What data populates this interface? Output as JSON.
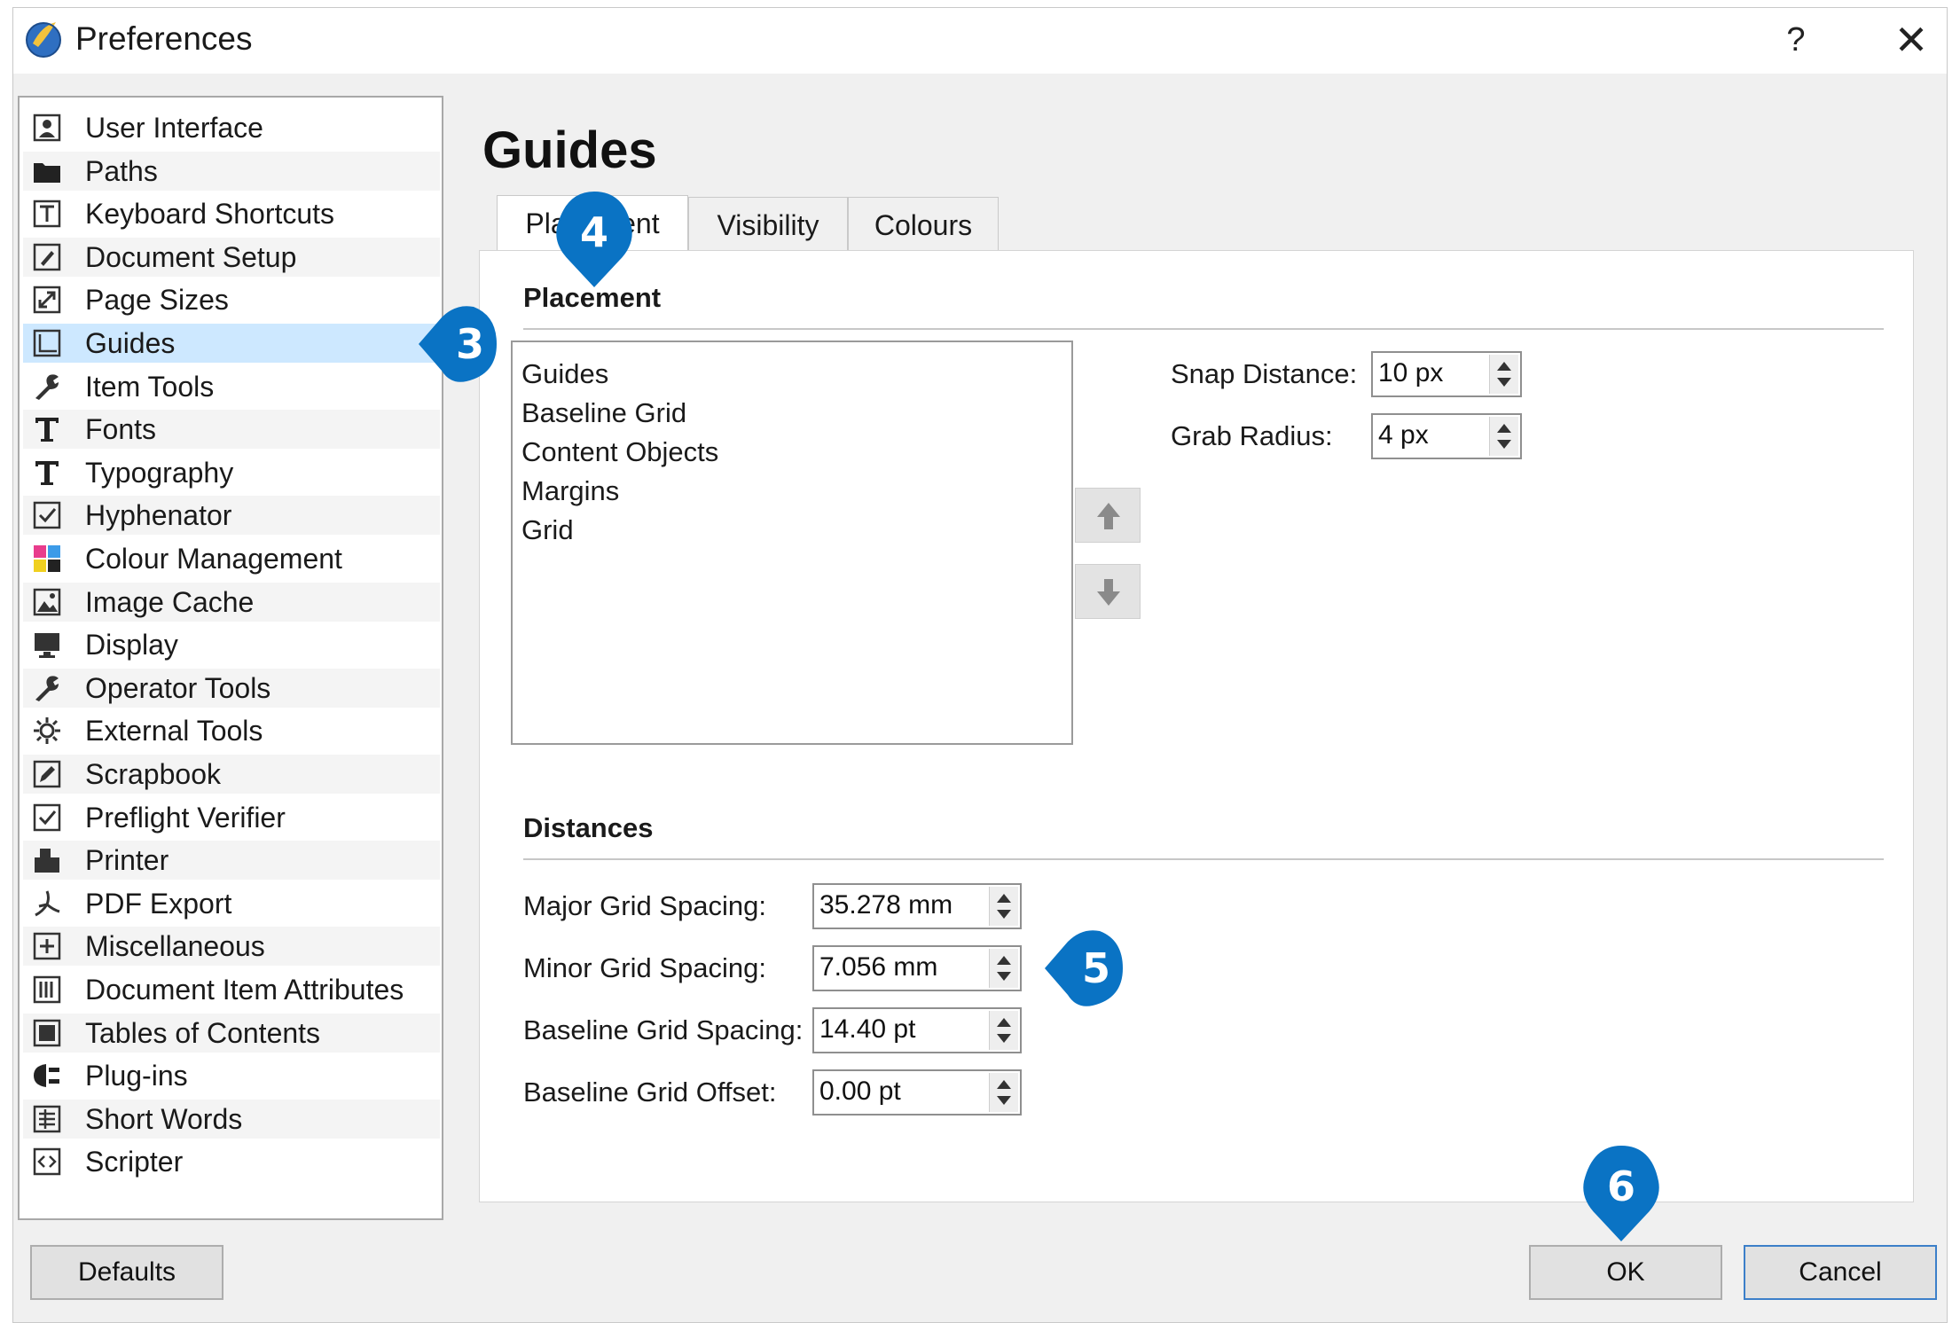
{
  "window": {
    "title": "Preferences",
    "help_label": "?",
    "close_label": "✕"
  },
  "sidebar": {
    "items": [
      {
        "label": "User Interface",
        "icon": "user-interface-icon"
      },
      {
        "label": "Paths",
        "icon": "folder-icon"
      },
      {
        "label": "Keyboard Shortcuts",
        "icon": "keyboard-icon"
      },
      {
        "label": "Document Setup",
        "icon": "document-setup-icon"
      },
      {
        "label": "Page Sizes",
        "icon": "page-sizes-icon"
      },
      {
        "label": "Guides",
        "icon": "guides-icon",
        "selected": true
      },
      {
        "label": "Item Tools",
        "icon": "wrench-icon"
      },
      {
        "label": "Fonts",
        "icon": "font-t-icon"
      },
      {
        "label": "Typography",
        "icon": "font-t-icon"
      },
      {
        "label": "Hyphenator",
        "icon": "checkbox-icon"
      },
      {
        "label": "Colour Management",
        "icon": "color-squares-icon"
      },
      {
        "label": "Image Cache",
        "icon": "image-icon"
      },
      {
        "label": "Display",
        "icon": "monitor-icon"
      },
      {
        "label": "Operator Tools",
        "icon": "wrench-icon"
      },
      {
        "label": "External Tools",
        "icon": "gear-icon"
      },
      {
        "label": "Scrapbook",
        "icon": "edit-icon"
      },
      {
        "label": "Preflight Verifier",
        "icon": "checkbox-icon"
      },
      {
        "label": "Printer",
        "icon": "printer-icon"
      },
      {
        "label": "PDF Export",
        "icon": "pdf-icon"
      },
      {
        "label": "Miscellaneous",
        "icon": "plus-box-icon"
      },
      {
        "label": "Document Item Attributes",
        "icon": "attributes-icon"
      },
      {
        "label": "Tables of Contents",
        "icon": "table-of-contents-icon"
      },
      {
        "label": "Plug-ins",
        "icon": "plugin-icon"
      },
      {
        "label": "Short Words",
        "icon": "short-words-icon"
      },
      {
        "label": "Scripter",
        "icon": "script-icon"
      }
    ]
  },
  "main": {
    "title": "Guides",
    "tabs": [
      {
        "label": "Placement",
        "active": true
      },
      {
        "label": "Visibility"
      },
      {
        "label": "Colours"
      }
    ],
    "placement": {
      "heading": "Placement",
      "order_list": [
        "Guides",
        "Baseline Grid",
        "Content Objects",
        "Margins",
        "Grid"
      ],
      "snap_distance": {
        "label": "Snap Distance:",
        "value": "10 px"
      },
      "grab_radius": {
        "label": "Grab Radius:",
        "value": "4 px"
      }
    },
    "distances": {
      "heading": "Distances",
      "major_grid": {
        "label": "Major Grid Spacing:",
        "value": "35.278 mm"
      },
      "minor_grid": {
        "label": "Minor Grid Spacing:",
        "value": "7.056 mm"
      },
      "baseline_spacing": {
        "label": "Baseline Grid Spacing:",
        "value": "14.40 pt"
      },
      "baseline_offset": {
        "label": "Baseline Grid Offset:",
        "value": "0.00 pt"
      }
    }
  },
  "buttons": {
    "defaults": "Defaults",
    "ok": "OK",
    "cancel": "Cancel"
  },
  "callouts": [
    "3",
    "4",
    "5",
    "6"
  ],
  "colors": {
    "callout_blue": "#0a73c4",
    "selection": "#cde8ff",
    "watermark_green": "#8fcf9a"
  }
}
